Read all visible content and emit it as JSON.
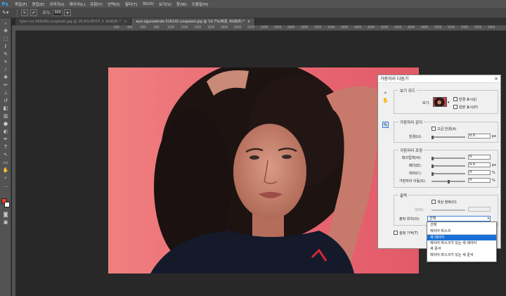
{
  "app": {
    "logo": "Ps"
  },
  "menu": [
    "파일(F)",
    "편집(E)",
    "이미지(I)",
    "레이어(L)",
    "유형(Y)",
    "선택(S)",
    "필터(T)",
    "3D(D)",
    "보기(V)",
    "창(W)",
    "도움말(H)"
  ],
  "options_bar": {
    "size_label": "크기:",
    "size_value": "300"
  },
  "tabs": [
    {
      "label": "tyler-nix-569180-unsplash.jpg @ 29.9%(레이어 3, RGB/8) *",
      "active": false
    },
    {
      "label": "ayo-ogunseinde-316141-unsplash.jpg @ 19.7%(배경, RGB/8) *",
      "active": true
    }
  ],
  "ruler_ticks": [
    "200",
    "400",
    "600",
    "800",
    "1000",
    "1200",
    "1400",
    "1600",
    "1800",
    "2000",
    "2200",
    "2400",
    "2600",
    "2800",
    "3000",
    "3200",
    "3400",
    "3600",
    "3800",
    "4000",
    "4200",
    "4400",
    "4600",
    "4800",
    "5000",
    "5200",
    "5400",
    "5600",
    "5800"
  ],
  "dialog": {
    "title": "가장자리 다듬기",
    "close": "×",
    "view_mode": {
      "title": "보기 모드",
      "view_label": "보기:",
      "show_radius": "반경 표시(J)",
      "show_original": "원본 표시(P)"
    },
    "edge_detection": {
      "title": "가장자리 감지",
      "smart_radius": "고급 반경(A)",
      "radius_label": "반경(U):",
      "radius_value": "0.0",
      "radius_unit": "px"
    },
    "adjust_edge": {
      "title": "가장자리 조정",
      "smooth_label": "매끄럽게(H):",
      "smooth_value": "0",
      "feather_label": "페더(E):",
      "feather_value": "0.0",
      "feather_unit": "px",
      "contrast_label": "대비(C):",
      "contrast_value": "0",
      "contrast_unit": "%",
      "shift_label": "가장자리 이동(S):",
      "shift_value": "0",
      "shift_unit": "%"
    },
    "output": {
      "title": "출력",
      "decontaminate": "색상 정화(D)",
      "amount_label": "양(N):",
      "output_to_label": "출력 위치(O):",
      "output_to_value": "선택",
      "remember": "설정 기억(T)"
    }
  },
  "dropdown": {
    "items": [
      "선택",
      "레이어 마스크",
      "새 레이어",
      "레이어 마스크가 있는 새 레이어",
      "새 문서",
      "레이어 마스크가 있는 새 문서"
    ],
    "highlighted_index": 2
  }
}
